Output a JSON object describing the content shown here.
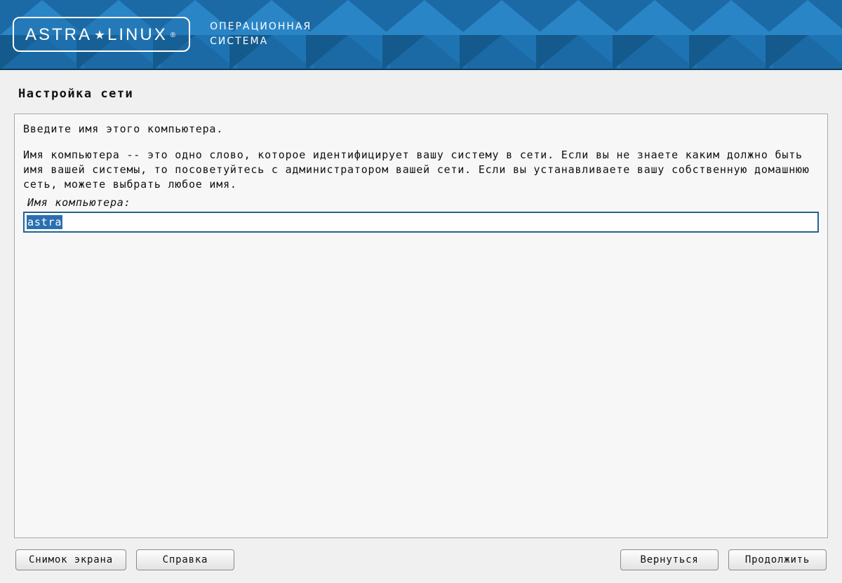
{
  "header": {
    "logo_word1": "ASTRA",
    "logo_word2": "LINUX",
    "logo_reg": "®",
    "tagline_line1": "ОПЕРАЦИОННАЯ",
    "tagline_line2": "СИСТЕМА"
  },
  "page": {
    "title": "Настройка сети",
    "intro": "Введите имя этого компьютера.",
    "body": "Имя компьютера -- это одно слово, которое идентифицирует вашу систему в сети. Если вы не знаете каким должно быть имя вашей системы, то посоветуйтесь с администратором вашей сети. Если вы устанавливаете вашу собственную домашнюю сеть, можете выбрать любое имя.",
    "field_label": "Имя компьютера:",
    "hostname_value": "astra"
  },
  "footer": {
    "screenshot": "Снимок экрана",
    "help": "Справка",
    "back": "Вернуться",
    "continue": "Продолжить"
  }
}
